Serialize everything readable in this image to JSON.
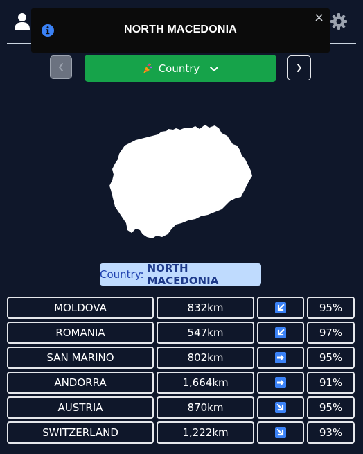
{
  "app": {
    "user_icon": "user-icon",
    "settings_icon": "gear-icon"
  },
  "toast": {
    "icon": "info-icon",
    "title": "NORTH MACEDONIA",
    "close_label": "×",
    "accent_color": "#3b82f6"
  },
  "nav": {
    "prev_icon": "chevron-left-icon",
    "next_icon": "chevron-right-icon"
  },
  "mode": {
    "icon": "party-popper-icon",
    "label": "Country",
    "dropdown_icon": "chevron-down-icon",
    "color": "#16a34a"
  },
  "answer": {
    "prefix": "Country:",
    "value": "NORTH MACEDONIA"
  },
  "guesses": [
    {
      "country": "MOLDOVA",
      "distance": "832km",
      "direction": "down-left",
      "proximity": "95%"
    },
    {
      "country": "ROMANIA",
      "distance": "547km",
      "direction": "down-left",
      "proximity": "97%"
    },
    {
      "country": "SAN MARINO",
      "distance": "802km",
      "direction": "right",
      "proximity": "95%"
    },
    {
      "country": "ANDORRA",
      "distance": "1,664km",
      "direction": "right",
      "proximity": "91%"
    },
    {
      "country": "AUSTRIA",
      "distance": "870km",
      "direction": "down-right",
      "proximity": "95%"
    },
    {
      "country": "SWITZERLAND",
      "distance": "1,222km",
      "direction": "down-right",
      "proximity": "93%"
    }
  ],
  "colors": {
    "background": "#0f172a",
    "arrow_box": "#3b82f6",
    "label_bg": "#bfdbfe"
  }
}
